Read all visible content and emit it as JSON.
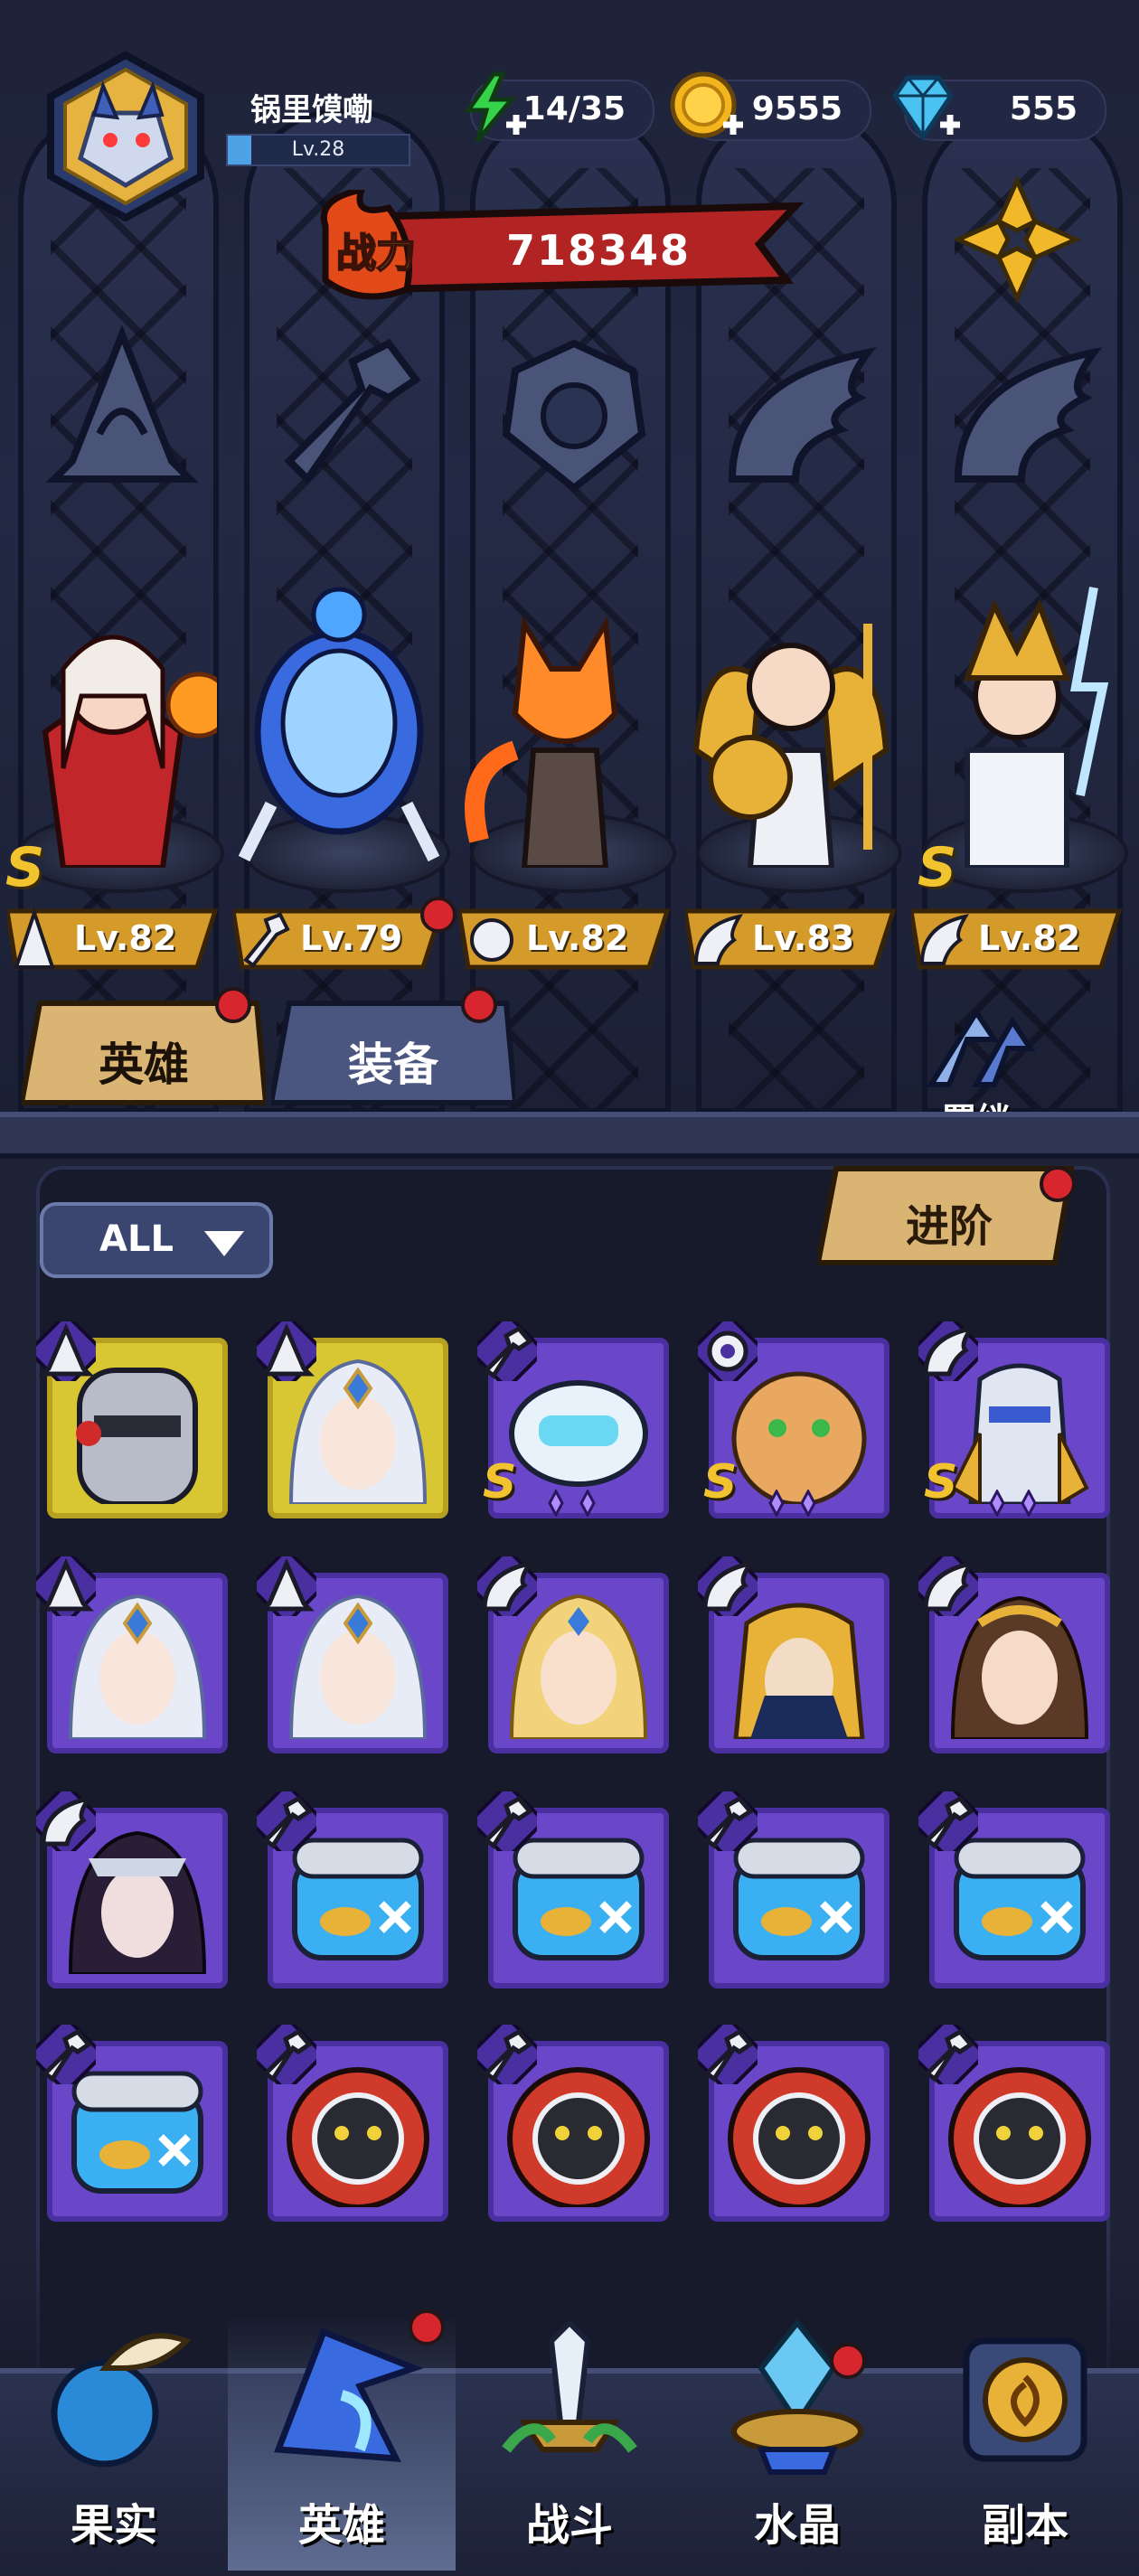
{
  "player": {
    "name": "锅里馍嘞",
    "level": "Lv.28"
  },
  "resources": {
    "energy": "14/35",
    "gold": "9555",
    "gems": "555"
  },
  "power": {
    "label": "战力",
    "value": "718348"
  },
  "heroes": [
    {
      "level": "Lv.82",
      "rank": "S",
      "class": "mage"
    },
    {
      "level": "Lv.79",
      "rank": "",
      "class": "mech"
    },
    {
      "level": "Lv.82",
      "rank": "",
      "class": "beast"
    },
    {
      "level": "Lv.83",
      "rank": "",
      "class": "wing"
    },
    {
      "level": "Lv.82",
      "rank": "S",
      "class": "wing"
    }
  ],
  "tabs": {
    "heroes": "英雄",
    "equipment": "装备",
    "bond": "羁绊"
  },
  "filter": {
    "selected": "ALL"
  },
  "advance_label": "进阶",
  "roster": [
    {
      "type": "knight",
      "frame": "gold",
      "class": "mage",
      "s": ""
    },
    {
      "type": "silver-lady",
      "frame": "gold",
      "class": "mage",
      "s": ""
    },
    {
      "type": "robot",
      "frame": "purple",
      "class": "mech",
      "s": "S"
    },
    {
      "type": "leopard",
      "frame": "purple",
      "class": "beast",
      "s": "S"
    },
    {
      "type": "armor",
      "frame": "purple",
      "class": "wing",
      "s": "S"
    },
    {
      "type": "silver-lady",
      "frame": "purple",
      "class": "mage",
      "s": ""
    },
    {
      "type": "silver-lady",
      "frame": "purple",
      "class": "mage",
      "s": ""
    },
    {
      "type": "blonde",
      "frame": "purple",
      "class": "wing",
      "s": ""
    },
    {
      "type": "pharaoh",
      "frame": "purple",
      "class": "wing",
      "s": ""
    },
    {
      "type": "laurel",
      "frame": "purple",
      "class": "wing",
      "s": ""
    },
    {
      "type": "dark-lady",
      "frame": "purple",
      "class": "wing",
      "s": ""
    },
    {
      "type": "fishtank",
      "frame": "purple",
      "class": "mech",
      "s": ""
    },
    {
      "type": "fishtank",
      "frame": "purple",
      "class": "mech",
      "s": ""
    },
    {
      "type": "fishtank",
      "frame": "purple",
      "class": "mech",
      "s": ""
    },
    {
      "type": "fishtank",
      "frame": "purple",
      "class": "mech",
      "s": ""
    },
    {
      "type": "fishtank",
      "frame": "purple",
      "class": "mech",
      "s": ""
    },
    {
      "type": "diver",
      "frame": "purple",
      "class": "mech",
      "s": ""
    },
    {
      "type": "diver",
      "frame": "purple",
      "class": "mech",
      "s": ""
    },
    {
      "type": "diver",
      "frame": "purple",
      "class": "mech",
      "s": ""
    },
    {
      "type": "diver",
      "frame": "purple",
      "class": "mech",
      "s": ""
    }
  ],
  "nav": [
    {
      "label": "果实",
      "icon": "fruit-icon"
    },
    {
      "label": "英雄",
      "icon": "wizard-hat-icon"
    },
    {
      "label": "战斗",
      "icon": "sword-icon"
    },
    {
      "label": "水晶",
      "icon": "crystal-icon"
    },
    {
      "label": "副本",
      "icon": "portal-icon"
    }
  ]
}
